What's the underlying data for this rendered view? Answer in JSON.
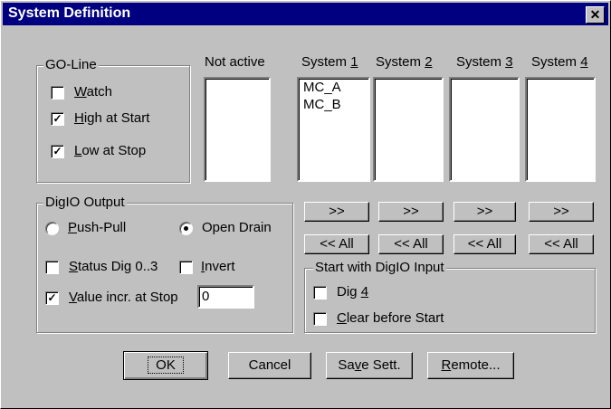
{
  "window": {
    "title": "System Definition",
    "close_glyph": "✕"
  },
  "go_line": {
    "label": "GO-Line",
    "watch": {
      "label": "Watch",
      "checked": false
    },
    "high_at_start": {
      "label": "High at Start",
      "checked": true
    },
    "low_at_stop": {
      "label": "Low at Stop",
      "checked": true
    }
  },
  "columns": {
    "not_active": {
      "label": "Not active",
      "items": []
    },
    "system1": {
      "label_pre": "System ",
      "label_key": "1",
      "items": [
        "MC_A",
        "MC_B"
      ]
    },
    "system2": {
      "label_pre": "System ",
      "label_key": "2",
      "items": []
    },
    "system3": {
      "label_pre": "System ",
      "label_key": "3",
      "items": []
    },
    "system4": {
      "label_pre": "System ",
      "label_key": "4",
      "items": []
    }
  },
  "move_buttons": {
    "move_label": ">>",
    "all_label": "<< All"
  },
  "digio_output": {
    "label": "DigIO Output",
    "push_pull": {
      "label": "Push-Pull",
      "selected": false
    },
    "open_drain": {
      "label": "Open Drain",
      "selected": true
    },
    "status_dig": {
      "label": "Status Dig 0..3",
      "checked": false
    },
    "invert": {
      "label": "Invert",
      "checked": false
    },
    "value_incr": {
      "label": "Value incr. at Stop",
      "checked": true,
      "value": "0"
    }
  },
  "start_with_digio": {
    "label": "Start with DigIO Input",
    "dig4": {
      "label": "Dig 4",
      "checked": false
    },
    "clear_before_start": {
      "label": "Clear before Start",
      "checked": false
    }
  },
  "buttons": {
    "ok": "OK",
    "cancel": "Cancel",
    "save": "Save Sett.",
    "remote": "Remote..."
  }
}
